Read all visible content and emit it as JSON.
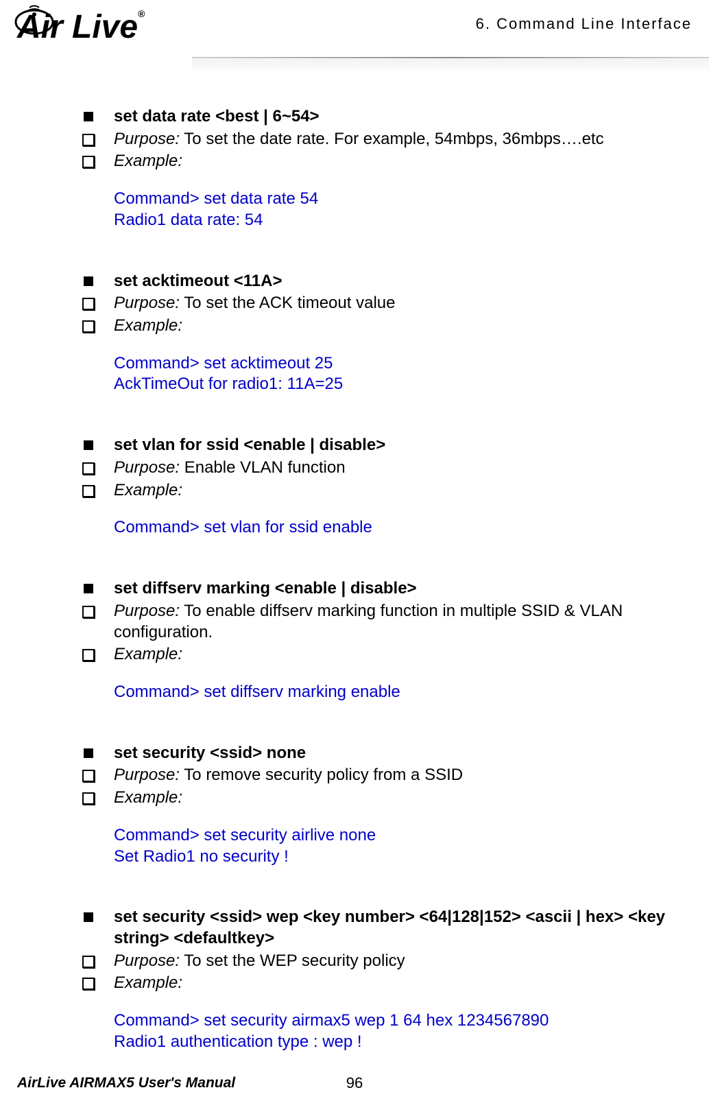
{
  "header": {
    "chapter": "6.  Command Line Interface",
    "logo_alt": "Air Live",
    "logo_reg": "®"
  },
  "sections": [
    {
      "title": "set data rate <best | 6~54>",
      "purpose_label": "Purpose:",
      "purpose_text": " To set the date rate.   For example, 54mbps, 36mbps….etc",
      "example_label": "Example:",
      "cmd": [
        "Command> set data rate 54",
        "Radio1 data rate: 54"
      ]
    },
    {
      "title": "set acktimeout <11A>",
      "purpose_label": "Purpose:",
      "purpose_text": " To set the ACK timeout value",
      "example_label": "Example:",
      "cmd": [
        "Command> set acktimeout 25",
        "AckTimeOut for radio1: 11A=25"
      ]
    },
    {
      "title": "set vlan for ssid <enable | disable>",
      "purpose_label": "Purpose:",
      "purpose_text": " Enable VLAN function",
      "example_label": "Example:",
      "cmd": [
        "Command> set vlan for ssid enable"
      ]
    },
    {
      "title": "set diffserv marking <enable | disable>",
      "purpose_label": "Purpose:",
      "purpose_text": " To enable diffserv marking function in multiple SSID & VLAN configuration.",
      "example_label": "Example:",
      "cmd": [
        "Command> set diffserv marking enable"
      ]
    },
    {
      "title": "set security <ssid> none",
      "purpose_label": "Purpose:",
      "purpose_text": " To remove security policy from a SSID",
      "example_label": "Example:",
      "cmd": [
        "Command> set security airlive none",
        "Set Radio1 no security !"
      ]
    },
    {
      "title": "set security <ssid> wep <key number> <64|128|152> <ascii | hex> <key string> <defaultkey>",
      "purpose_label": "Purpose:",
      "purpose_text": " To set the WEP security policy",
      "example_label": "Example:",
      "cmd": [
        "Command> set security airmax5 wep 1 64 hex 1234567890",
        "Radio1 authentication type : wep !"
      ]
    }
  ],
  "footer": {
    "manual": "AirLive AIRMAX5 User's Manual",
    "page": "96"
  }
}
